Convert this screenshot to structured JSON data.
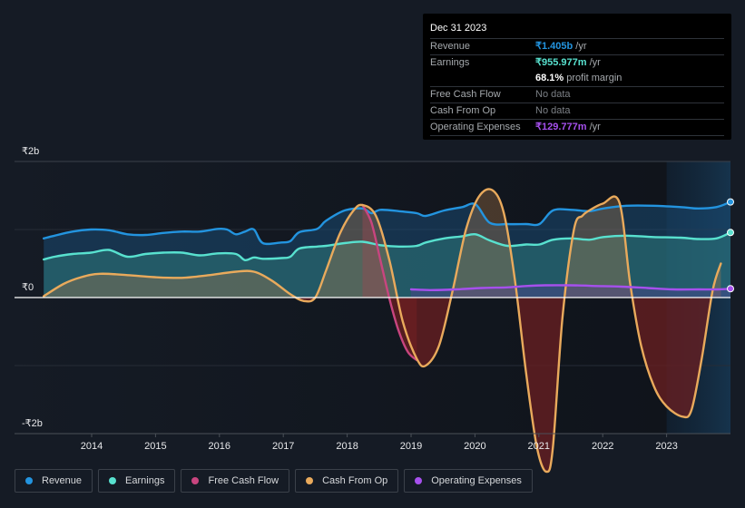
{
  "tooltip": {
    "date": "Dec 31 2023",
    "rows": [
      {
        "label": "Revenue",
        "value": "₹1.405b",
        "suffix": " /yr",
        "color": "#2394df"
      },
      {
        "label": "Earnings",
        "value": "₹955.977m",
        "suffix": " /yr",
        "color": "#58e1cf"
      },
      {
        "label": "",
        "value": "68.1%",
        "suffix": " profit margin",
        "color": "#ffffff"
      },
      {
        "label": "Free Cash Flow",
        "value": "No data",
        "suffix": "",
        "color": "#7c8086"
      },
      {
        "label": "Cash From Op",
        "value": "No data",
        "suffix": "",
        "color": "#7c8086"
      },
      {
        "label": "Operating Expenses",
        "value": "₹129.777m",
        "suffix": " /yr",
        "color": "#a650ed"
      }
    ]
  },
  "legend": [
    {
      "label": "Revenue",
      "color": "#2394df"
    },
    {
      "label": "Earnings",
      "color": "#58e1cf"
    },
    {
      "label": "Free Cash Flow",
      "color": "#c8457f"
    },
    {
      "label": "Cash From Op",
      "color": "#e9aa5c"
    },
    {
      "label": "Operating Expenses",
      "color": "#a650ed"
    }
  ],
  "chart_data": {
    "type": "area",
    "title": "",
    "xlabel": "",
    "ylabel": "",
    "units": "₹ billions",
    "ylim": [
      -2,
      2
    ],
    "xlim": [
      2013.25,
      2024.0
    ],
    "yticks": [
      {
        "value": 2,
        "label": "₹2b"
      },
      {
        "value": 0,
        "label": "₹0"
      },
      {
        "value": -2,
        "label": "-₹2b"
      }
    ],
    "xticks": [
      {
        "value": 2014,
        "label": "2014"
      },
      {
        "value": 2015,
        "label": "2015"
      },
      {
        "value": 2016,
        "label": "2016"
      },
      {
        "value": 2017,
        "label": "2017"
      },
      {
        "value": 2018,
        "label": "2018"
      },
      {
        "value": 2019,
        "label": "2019"
      },
      {
        "value": 2020,
        "label": "2020"
      },
      {
        "value": 2021,
        "label": "2021"
      },
      {
        "value": 2022,
        "label": "2022"
      },
      {
        "value": 2023,
        "label": "2023"
      }
    ],
    "grid": true,
    "highlight_from": 2023.0,
    "legend_position": "bottom",
    "series": [
      {
        "name": "Revenue",
        "color": "#2394df",
        "x": [
          2013.25,
          2013.42,
          2013.7,
          2013.99,
          2014.27,
          2014.56,
          2014.84,
          2015.12,
          2015.41,
          2015.69,
          2015.98,
          2016.12,
          2016.26,
          2016.4,
          2016.54,
          2016.68,
          2016.97,
          2017.11,
          2017.25,
          2017.53,
          2017.67,
          2017.96,
          2018.24,
          2018.38,
          2018.52,
          2018.81,
          2019.09,
          2019.23,
          2019.52,
          2019.8,
          2020.01,
          2020.23,
          2020.51,
          2020.8,
          2021.01,
          2021.22,
          2021.51,
          2021.79,
          2022.01,
          2022.37,
          2022.79,
          2023.22,
          2023.5,
          2023.78,
          2024.0
        ],
        "values": [
          0.87,
          0.91,
          0.97,
          1.0,
          0.99,
          0.93,
          0.92,
          0.95,
          0.97,
          0.97,
          1.01,
          1.0,
          0.93,
          0.97,
          1.0,
          0.8,
          0.81,
          0.83,
          0.96,
          1.01,
          1.13,
          1.28,
          1.31,
          1.24,
          1.29,
          1.27,
          1.24,
          1.2,
          1.28,
          1.33,
          1.37,
          1.1,
          1.08,
          1.08,
          1.08,
          1.28,
          1.29,
          1.27,
          1.31,
          1.35,
          1.35,
          1.33,
          1.31,
          1.33,
          1.405
        ]
      },
      {
        "name": "Earnings",
        "color": "#58e1cf",
        "x": [
          2013.25,
          2013.42,
          2013.7,
          2013.99,
          2014.27,
          2014.56,
          2014.84,
          2015.12,
          2015.41,
          2015.69,
          2015.98,
          2016.26,
          2016.4,
          2016.54,
          2016.68,
          2016.97,
          2017.11,
          2017.25,
          2017.53,
          2017.67,
          2017.96,
          2018.24,
          2018.52,
          2018.81,
          2019.09,
          2019.23,
          2019.52,
          2019.8,
          2020.01,
          2020.23,
          2020.51,
          2020.8,
          2021.01,
          2021.22,
          2021.51,
          2021.79,
          2022.01,
          2022.37,
          2022.79,
          2023.22,
          2023.5,
          2023.78,
          2024.0
        ],
        "values": [
          0.56,
          0.6,
          0.64,
          0.66,
          0.7,
          0.6,
          0.64,
          0.66,
          0.66,
          0.62,
          0.65,
          0.64,
          0.55,
          0.59,
          0.57,
          0.58,
          0.6,
          0.72,
          0.75,
          0.76,
          0.8,
          0.82,
          0.77,
          0.75,
          0.76,
          0.81,
          0.87,
          0.9,
          0.93,
          0.84,
          0.76,
          0.78,
          0.78,
          0.85,
          0.87,
          0.85,
          0.89,
          0.91,
          0.89,
          0.88,
          0.86,
          0.87,
          0.956
        ]
      },
      {
        "name": "Free Cash Flow",
        "color": "#c8457f",
        "x": [
          2018.24,
          2018.38,
          2018.52,
          2018.67,
          2018.81,
          2018.95,
          2019.09
        ],
        "values": [
          1.36,
          1.1,
          0.55,
          -0.05,
          -0.5,
          -0.8,
          -0.92
        ]
      },
      {
        "name": "Cash From Op",
        "color": "#e9aa5c",
        "x": [
          2013.25,
          2013.56,
          2013.84,
          2014.13,
          2014.56,
          2014.98,
          2015.41,
          2015.84,
          2016.26,
          2016.54,
          2016.82,
          2017.11,
          2017.32,
          2017.5,
          2017.67,
          2017.89,
          2018.1,
          2018.24,
          2018.45,
          2018.66,
          2018.87,
          2019.09,
          2019.23,
          2019.44,
          2019.65,
          2019.86,
          2020.06,
          2020.27,
          2020.45,
          2020.62,
          2020.8,
          2020.97,
          2021.12,
          2021.22,
          2021.37,
          2021.55,
          2021.68,
          2021.79,
          2022.0,
          2022.26,
          2022.43,
          2022.6,
          2022.8,
          2023.0,
          2023.25,
          2023.39,
          2023.55,
          2023.72,
          2023.85
        ],
        "values": [
          0.02,
          0.2,
          0.3,
          0.35,
          0.33,
          0.3,
          0.29,
          0.33,
          0.38,
          0.38,
          0.25,
          0.05,
          -0.05,
          0.0,
          0.4,
          0.95,
          1.28,
          1.36,
          1.2,
          0.55,
          -0.35,
          -0.9,
          -1.0,
          -0.7,
          0.1,
          1.0,
          1.48,
          1.58,
          1.25,
          0.3,
          -1.1,
          -2.2,
          -2.56,
          -2.2,
          -0.3,
          1.0,
          1.2,
          1.28,
          1.38,
          1.4,
          0.2,
          -0.7,
          -1.3,
          -1.6,
          -1.75,
          -1.65,
          -0.9,
          0.1,
          0.5
        ]
      },
      {
        "name": "Operating Expenses",
        "color": "#a650ed",
        "x": [
          2019.0,
          2019.3,
          2019.7,
          2020.1,
          2020.5,
          2020.8,
          2021.1,
          2021.5,
          2021.9,
          2022.3,
          2022.7,
          2023.1,
          2023.5,
          2023.8,
          2024.0
        ],
        "values": [
          0.12,
          0.11,
          0.12,
          0.14,
          0.15,
          0.17,
          0.18,
          0.18,
          0.17,
          0.16,
          0.14,
          0.12,
          0.12,
          0.12,
          0.13
        ]
      }
    ]
  }
}
